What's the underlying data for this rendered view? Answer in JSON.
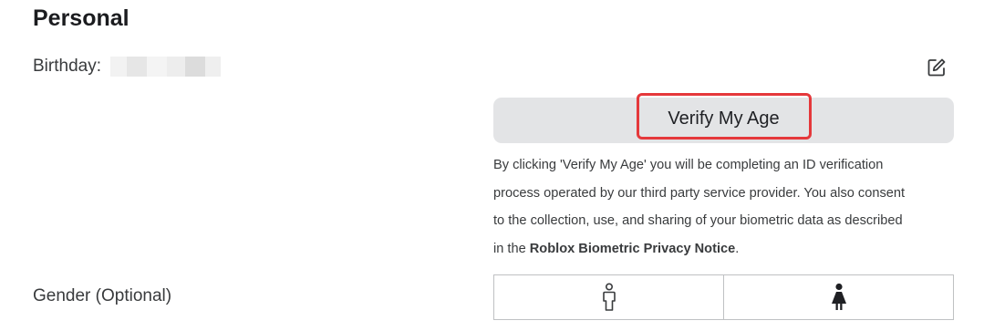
{
  "section": {
    "title": "Personal"
  },
  "birthday": {
    "label": "Birthday:",
    "value_redacted": true,
    "edit_icon": "pencil-square-icon"
  },
  "verify": {
    "button_label": "Verify My Age",
    "highlight_color": "#e5383b",
    "disclaimer": {
      "line1": "By clicking 'Verify My Age' you will be completing an ID verification",
      "line2": "process operated by our third party service provider. You also consent",
      "line3": "to the collection, use, and sharing of your biometric data as described",
      "line4_prefix": "in the ",
      "link": "Roblox Biometric Privacy Notice",
      "line4_suffix": "."
    }
  },
  "gender": {
    "label": "Gender (Optional)",
    "options": [
      {
        "icon": "male-figure-icon",
        "selected": false
      },
      {
        "icon": "female-figure-icon",
        "selected": false
      }
    ]
  },
  "colors": {
    "button_bg": "#e3e4e6",
    "text_primary": "#1f2024",
    "text_secondary": "#393b3d"
  }
}
